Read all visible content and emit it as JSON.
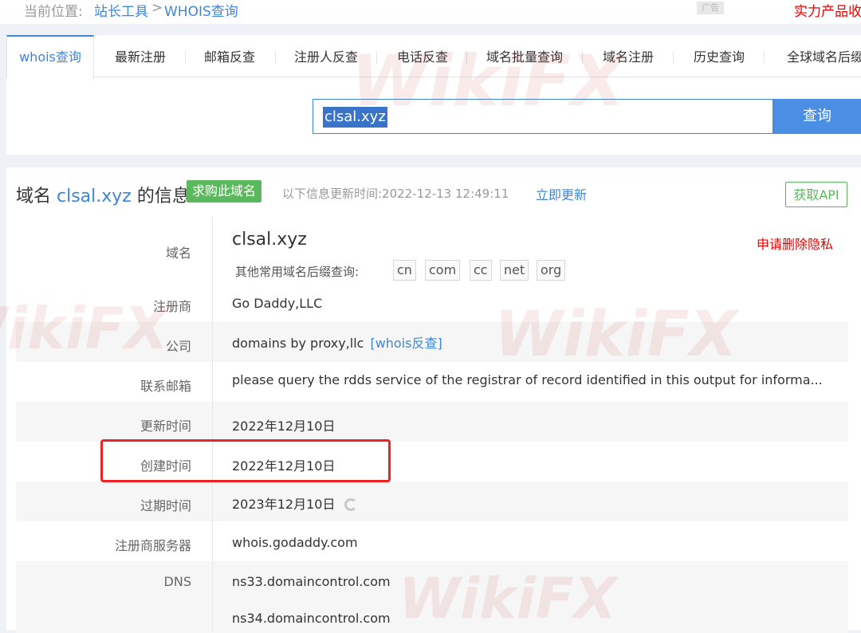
{
  "breadcrumb": {
    "prefix": "当前位置:",
    "home": "站长工具",
    "sep": ">",
    "current": "WHOIS查询",
    "ad_tag": "广告",
    "promo": "实力产品收录"
  },
  "tabs": [
    "whois查询",
    "最新注册",
    "邮箱反查",
    "注册人反查",
    "电话反查",
    "域名批量查询",
    "域名注册",
    "历史查询",
    "全球域名后缀"
  ],
  "search": {
    "value": "clsal.xyz",
    "button": "查询"
  },
  "info": {
    "title_prefix": "域名",
    "title_domain": "clsal.xyz",
    "title_suffix": "的信息",
    "buy_label": "求购此域名",
    "update_text": "以下信息更新时间:2022-12-13 12:49:11",
    "update_link": "立即更新",
    "api_button": "获取API",
    "privacy_link": "申请删除隐私",
    "suffix_label": "其他常用域名后缀查询:",
    "suffixes": [
      "cn",
      "com",
      "cc",
      "net",
      "org"
    ],
    "whois_reverse": "[whois反查]"
  },
  "rows": [
    {
      "label": "域名",
      "value": "clsal.xyz"
    },
    {
      "label": "注册商",
      "value": "Go Daddy,LLC"
    },
    {
      "label": "公司",
      "value": "domains by proxy,llc"
    },
    {
      "label": "联系邮箱",
      "value": "please query the rdds service of the registrar of record identified in this output for informa..."
    },
    {
      "label": "更新时间",
      "value": "2022年12月10日"
    },
    {
      "label": "创建时间",
      "value": "2022年12月10日"
    },
    {
      "label": "过期时间",
      "value": "2023年12月10日"
    },
    {
      "label": "注册商服务器",
      "value": "whois.godaddy.com"
    },
    {
      "label": "DNS",
      "value": "ns33.domaincontrol.com"
    },
    {
      "label": "",
      "value": "ns34.domaincontrol.com"
    }
  ],
  "watermark": "WikiFX",
  "colors": {
    "accent": "#3f86d8",
    "green": "#5cb85c",
    "red": "#e00000",
    "highlight": "#e22222"
  }
}
